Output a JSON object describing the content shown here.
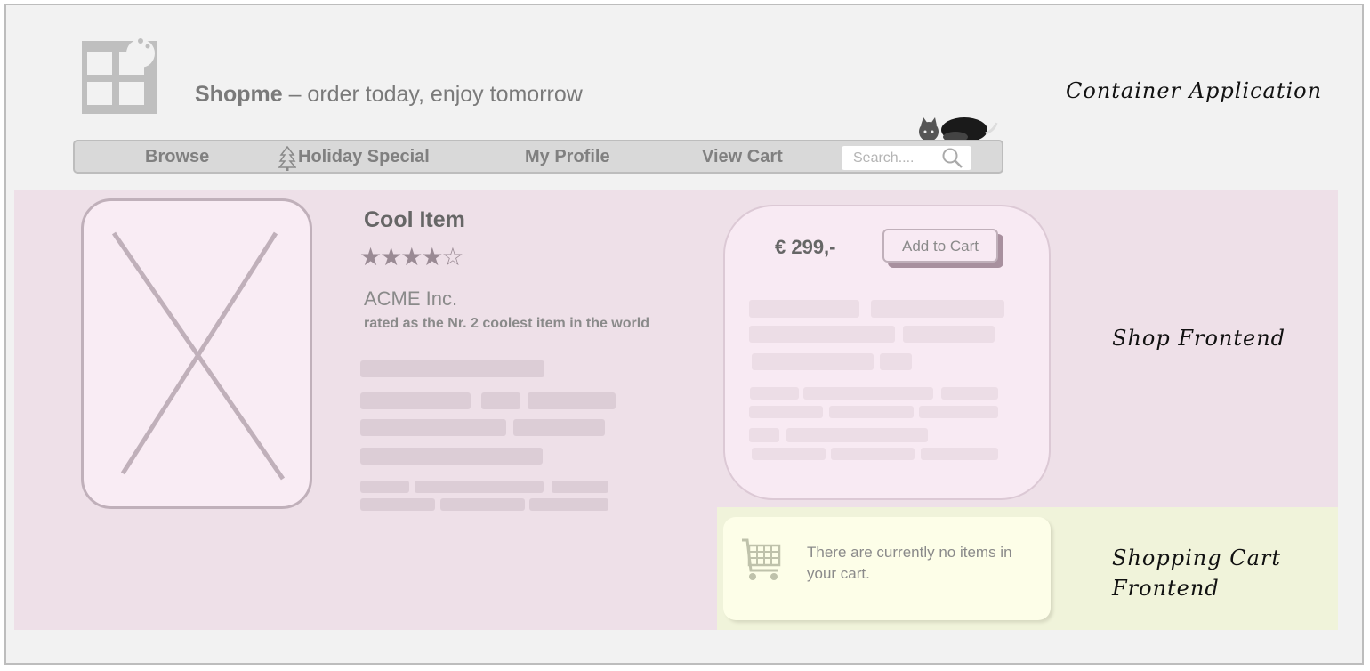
{
  "header": {
    "brand_name": "Shopme",
    "tagline": " – order today, enjoy tomorrow",
    "logo_icon": "bitten-window-logo"
  },
  "nav": {
    "items": [
      {
        "label": "Browse"
      },
      {
        "label": "Holiday Special",
        "icon": "tree-icon"
      },
      {
        "label": "My Profile"
      },
      {
        "label": "View Cart"
      }
    ],
    "search_placeholder": "Search....",
    "search_icon": "magnifier-icon"
  },
  "regions": {
    "container": "Container Application",
    "shop": "Shop Frontend",
    "cart_line1": "Shopping Cart",
    "cart_line2": "Frontend"
  },
  "product": {
    "title": "Cool Item",
    "stars": "★★★★☆",
    "rating_value": 4,
    "rating_max": 5,
    "maker": "ACME Inc.",
    "rating_text": "rated as the Nr. 2 coolest item in the world",
    "image_icon": "placeholder-image-icon"
  },
  "buy": {
    "price": "€ 299,-",
    "add_label": "Add to Cart"
  },
  "cart": {
    "empty_text": "There are currently no items in your cart.",
    "cart_icon": "shopping-cart-icon"
  },
  "colors": {
    "shop_bg": "#eee0e8",
    "cart_bg": "#f0f3da",
    "container_bg": "#f2f2f2"
  }
}
